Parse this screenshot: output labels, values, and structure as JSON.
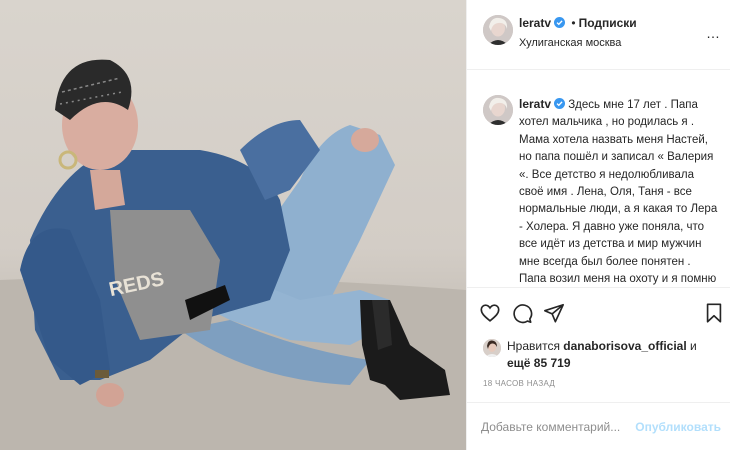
{
  "post": {
    "username": "leratv",
    "follow_label": "Подписки",
    "separator": "•",
    "location": "Хулиганская москва",
    "more_label": "…",
    "caption": "Здесь мне 17 лет . Папа хотел мальчика , но родилась я . Мама хотела назвать меня Настей, но папа пошёл и записал « Валерия «. Все детство я недолюбливала своё имя . Лена, Оля, Таня - все нормальные люди, а я какая то Лера - Холера. Я давно уже поняла, что все идёт из детства и мир мужчин мне всегда был более понятен . Папа возил меня на охоту и я помню",
    "likes_prefix": "Нравится",
    "likes_user": "danaborisova_official",
    "likes_and": "и",
    "likes_more": "ещё 85 719",
    "timestamp": "18 ЧАСОВ НАЗАД",
    "comment_placeholder": "Добавьте комментарий...",
    "publish_label": "Опубликовать"
  },
  "photo": {
    "tshirt_text": "REDS"
  },
  "icons": {
    "verified": "verified-badge-icon",
    "like": "heart-icon",
    "comment": "comment-icon",
    "share": "paper-plane-icon",
    "save": "bookmark-icon"
  },
  "colors": {
    "verified": "#3897f0",
    "publish": "#b2dffc",
    "muted": "#8e8e8e"
  }
}
